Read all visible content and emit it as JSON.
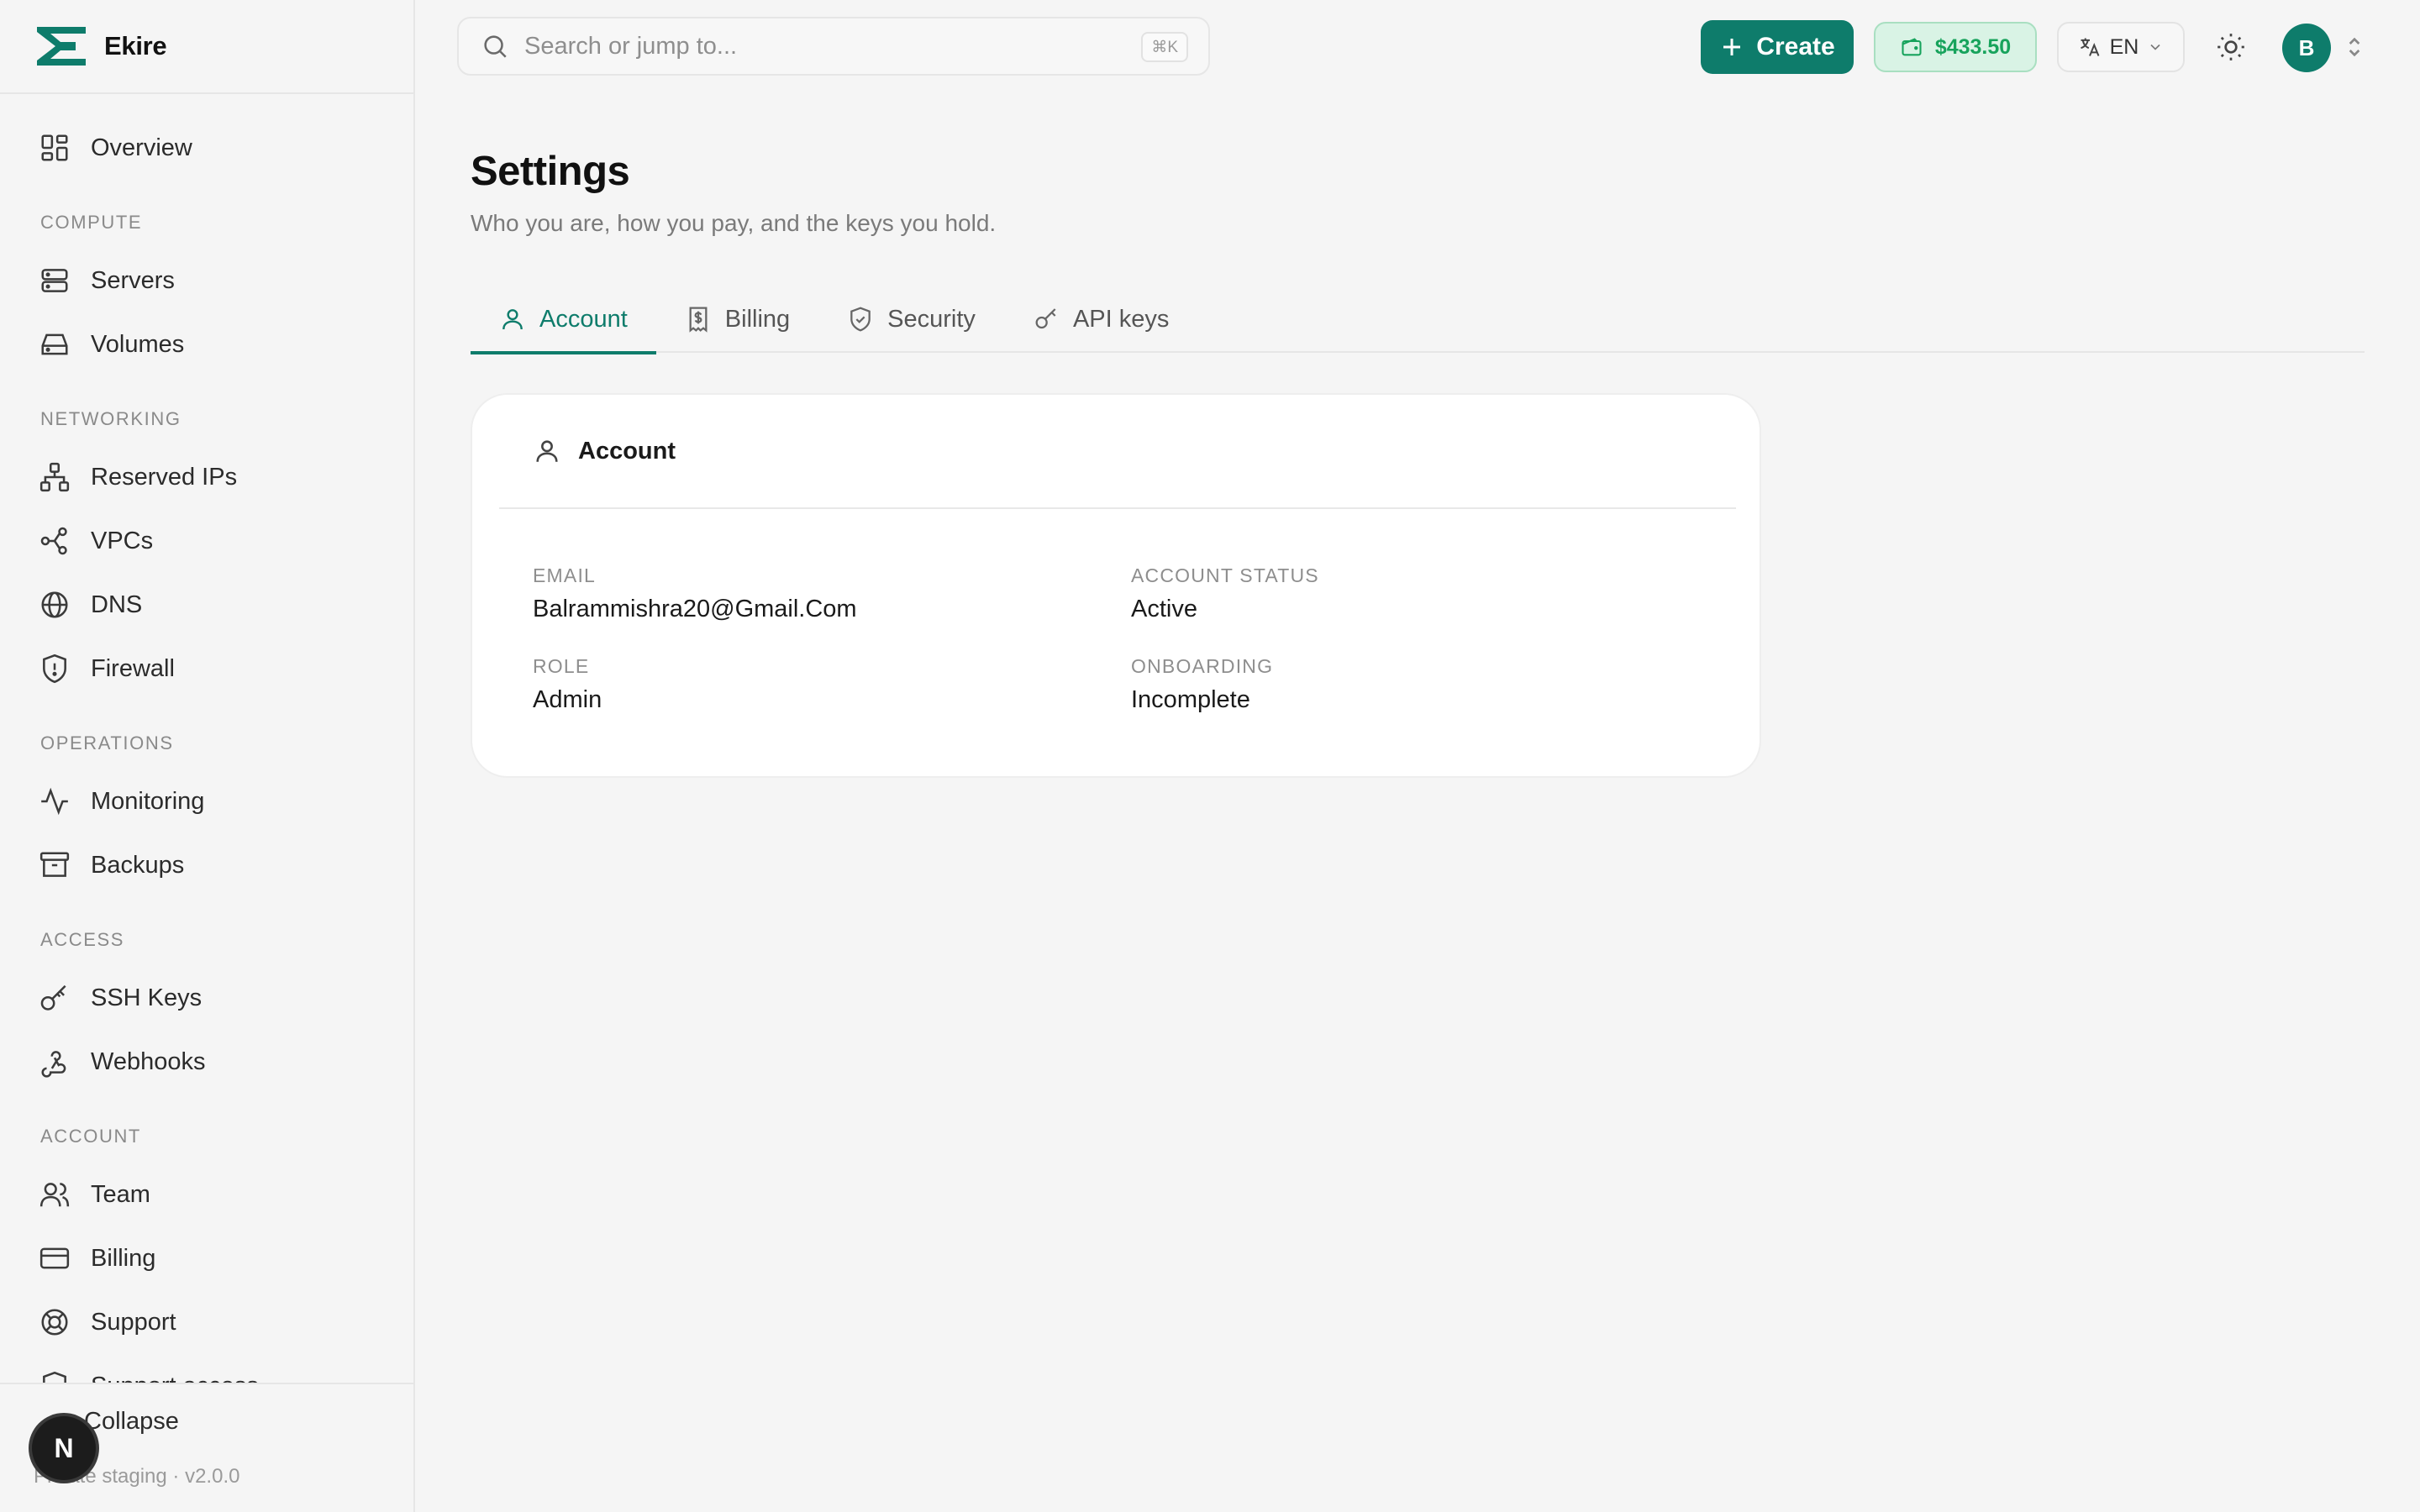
{
  "brand": {
    "name": "Ekire"
  },
  "sidebar": {
    "overview": "Overview",
    "sections": {
      "compute": "COMPUTE",
      "networking": "NETWORKING",
      "operations": "OPERATIONS",
      "access": "ACCESS",
      "account": "ACCOUNT"
    },
    "items": {
      "servers": "Servers",
      "volumes": "Volumes",
      "reserved_ips": "Reserved IPs",
      "vpcs": "VPCs",
      "dns": "DNS",
      "firewall": "Firewall",
      "monitoring": "Monitoring",
      "backups": "Backups",
      "ssh_keys": "SSH Keys",
      "webhooks": "Webhooks",
      "team": "Team",
      "billing": "Billing",
      "support": "Support",
      "support_access": "Support access"
    },
    "collapse": "Collapse",
    "version": "Private staging · v2.0.0",
    "dev_badge": "N"
  },
  "topbar": {
    "search_placeholder": "Search or jump to...",
    "search_shortcut": "⌘K",
    "create_label": "Create",
    "balance": "$433.50",
    "language": "EN",
    "avatar_initial": "B"
  },
  "page": {
    "title": "Settings",
    "subtitle": "Who you are, how you pay, and the keys you hold."
  },
  "tabs": [
    {
      "label": "Account",
      "active": true,
      "icon": "user-icon"
    },
    {
      "label": "Billing",
      "active": false,
      "icon": "receipt-icon"
    },
    {
      "label": "Security",
      "active": false,
      "icon": "shield-check-icon"
    },
    {
      "label": "API keys",
      "active": false,
      "icon": "key-icon"
    }
  ],
  "account_card": {
    "title": "Account",
    "fields": {
      "email": {
        "label": "EMAIL",
        "value": "Balrammishra20@Gmail.Com"
      },
      "status": {
        "label": "ACCOUNT STATUS",
        "value": "Active"
      },
      "role": {
        "label": "ROLE",
        "value": "Admin"
      },
      "onboarding": {
        "label": "ONBOARDING",
        "value": "Incomplete"
      }
    }
  },
  "colors": {
    "accent": "#0e7c6b",
    "balance_text": "#17a35c",
    "balance_bg": "#d9f3e5"
  }
}
